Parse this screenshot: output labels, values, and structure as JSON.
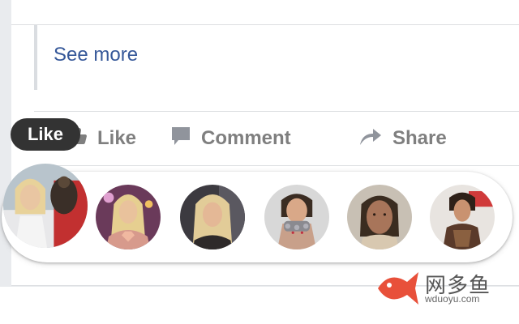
{
  "post": {
    "see_more_label": "See more"
  },
  "actions": {
    "like_label": "Like",
    "comment_label": "Comment",
    "share_label": "Share"
  },
  "tooltip": {
    "label": "Like"
  },
  "reactions": {
    "count_shown": 6,
    "avatars": [
      "avatar-1",
      "avatar-2",
      "avatar-3",
      "avatar-4",
      "avatar-5",
      "avatar-6"
    ]
  },
  "watermark": {
    "brand": "网多鱼",
    "domain": "wduoyu.com",
    "accent": "#e8503a"
  },
  "colors": {
    "link": "#365899",
    "action_text": "#7f7f7f",
    "page_bg": "#e9ebee"
  }
}
